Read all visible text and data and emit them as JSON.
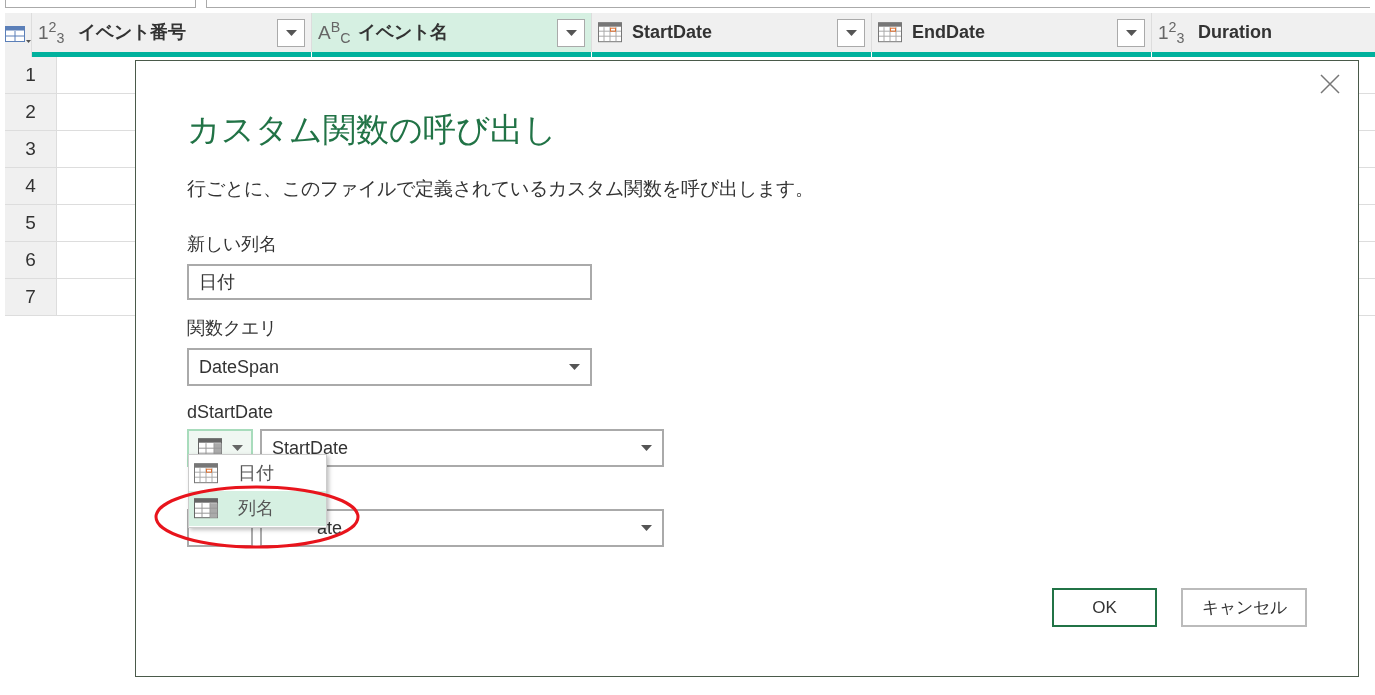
{
  "columns": [
    {
      "name": "イベント番号",
      "kind": "number",
      "type_label": "1$^{2}$$_{3}$",
      "selected": false
    },
    {
      "name": "イベント名",
      "kind": "text",
      "type_label": "A$^{B}$$_{C}$",
      "selected": true
    },
    {
      "name": "StartDate",
      "kind": "date",
      "selected": false
    },
    {
      "name": "EndDate",
      "kind": "date",
      "selected": false
    },
    {
      "name": "Duration",
      "kind": "number",
      "type_label": "1$^{2}$$_{3}$",
      "selected": false
    }
  ],
  "row_numbers": [
    "1",
    "2",
    "3",
    "4",
    "5",
    "6",
    "7"
  ],
  "dialog": {
    "title": "カスタム関数の呼び出し",
    "description": "行ごとに、このファイルで定義されているカスタム関数を呼び出します。",
    "new_column_label": "新しい列名",
    "new_column_value": "日付",
    "function_label": "関数クエリ",
    "function_value": "DateSpan",
    "param_label": "dStartDate",
    "param_value": "StartDate",
    "second_param_value": "ate",
    "menu": [
      {
        "label": "日付",
        "kind": "date",
        "selected": false
      },
      {
        "label": "列名",
        "kind": "column",
        "selected": true
      }
    ],
    "ok": "OK",
    "cancel": "キャンセル"
  }
}
